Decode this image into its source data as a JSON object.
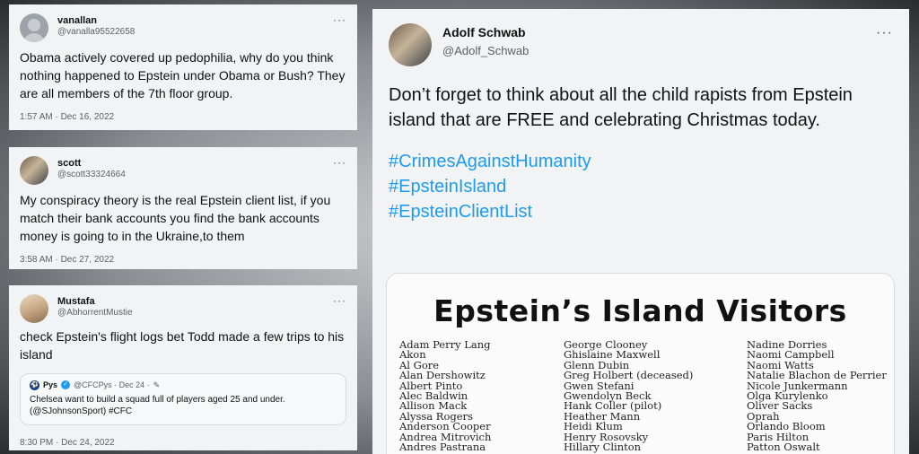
{
  "tweets": [
    {
      "name": "vanallan",
      "handle": "@vanalla95522658",
      "text": "Obama actively covered up pedophilia, why do you think nothing happened to Epstein under Obama or Bush? They are all members of the 7th floor group.",
      "time": "1:57 AM · Dec 16, 2022"
    },
    {
      "name": "scott",
      "handle": "@scott33324664",
      "text": "My conspiracy theory is the real Epstein client list, if you match their bank accounts you find the bank accounts  money is going to in the Ukraine,to them",
      "time": "3:58 AM · Dec 27, 2022"
    },
    {
      "name": "Mustafa",
      "handle": "@AbhorrentMustie",
      "text": "check Epstein's flight logs bet Todd made a few trips to his island",
      "quote": {
        "name": "Pys",
        "handle": "@CFCPys · Dec 24 ·",
        "text": "Chelsea want to build a squad full of players aged 25 and under. (@SJohnsonSport) #CFC"
      },
      "time": "8:30 PM · Dec 24, 2022"
    }
  ],
  "main_tweet": {
    "name": "Adolf Schwab",
    "handle": "@Adolf_Schwab",
    "text": "Don’t forget to think about all the child rapists from Epstein island that are FREE and celebrating Christmas today.",
    "hashtags": [
      "#CrimesAgainstHumanity",
      "#EpsteinIsland",
      "#EpsteinClientList"
    ],
    "media": {
      "title": "Epstein’s Island Visitors",
      "columns": [
        [
          "Adam Perry Lang",
          "Akon",
          "Al Gore",
          "Alan Dershowitz",
          "Albert Pinto",
          "Alec Baldwin",
          "Allison Mack",
          "Alyssa Rogers",
          "Anderson Cooper",
          "Andrea Mitrovich",
          "Andres Pastrana"
        ],
        [
          "George Clooney",
          "Ghislaine Maxwell",
          "Glenn Dubin",
          "Greg Holbert (deceased)",
          "Gwen Stefani",
          "Gwendolyn Beck",
          "Hank Coller (pilot)",
          "Heather Mann",
          "Heidi Klum",
          "Henry Rosovsky",
          "Hillary Clinton"
        ],
        [
          "Nadine Dorries",
          "Naomi Campbell",
          "Naomi Watts",
          "Natalie Blachon de Perrier",
          "Nicole Junkermann",
          "Olga Kurylenko",
          "Oliver Sacks",
          "Oprah",
          "Orlando Bloom",
          "Paris Hilton",
          "Patton Oswalt"
        ]
      ]
    }
  },
  "more_glyph": "···"
}
